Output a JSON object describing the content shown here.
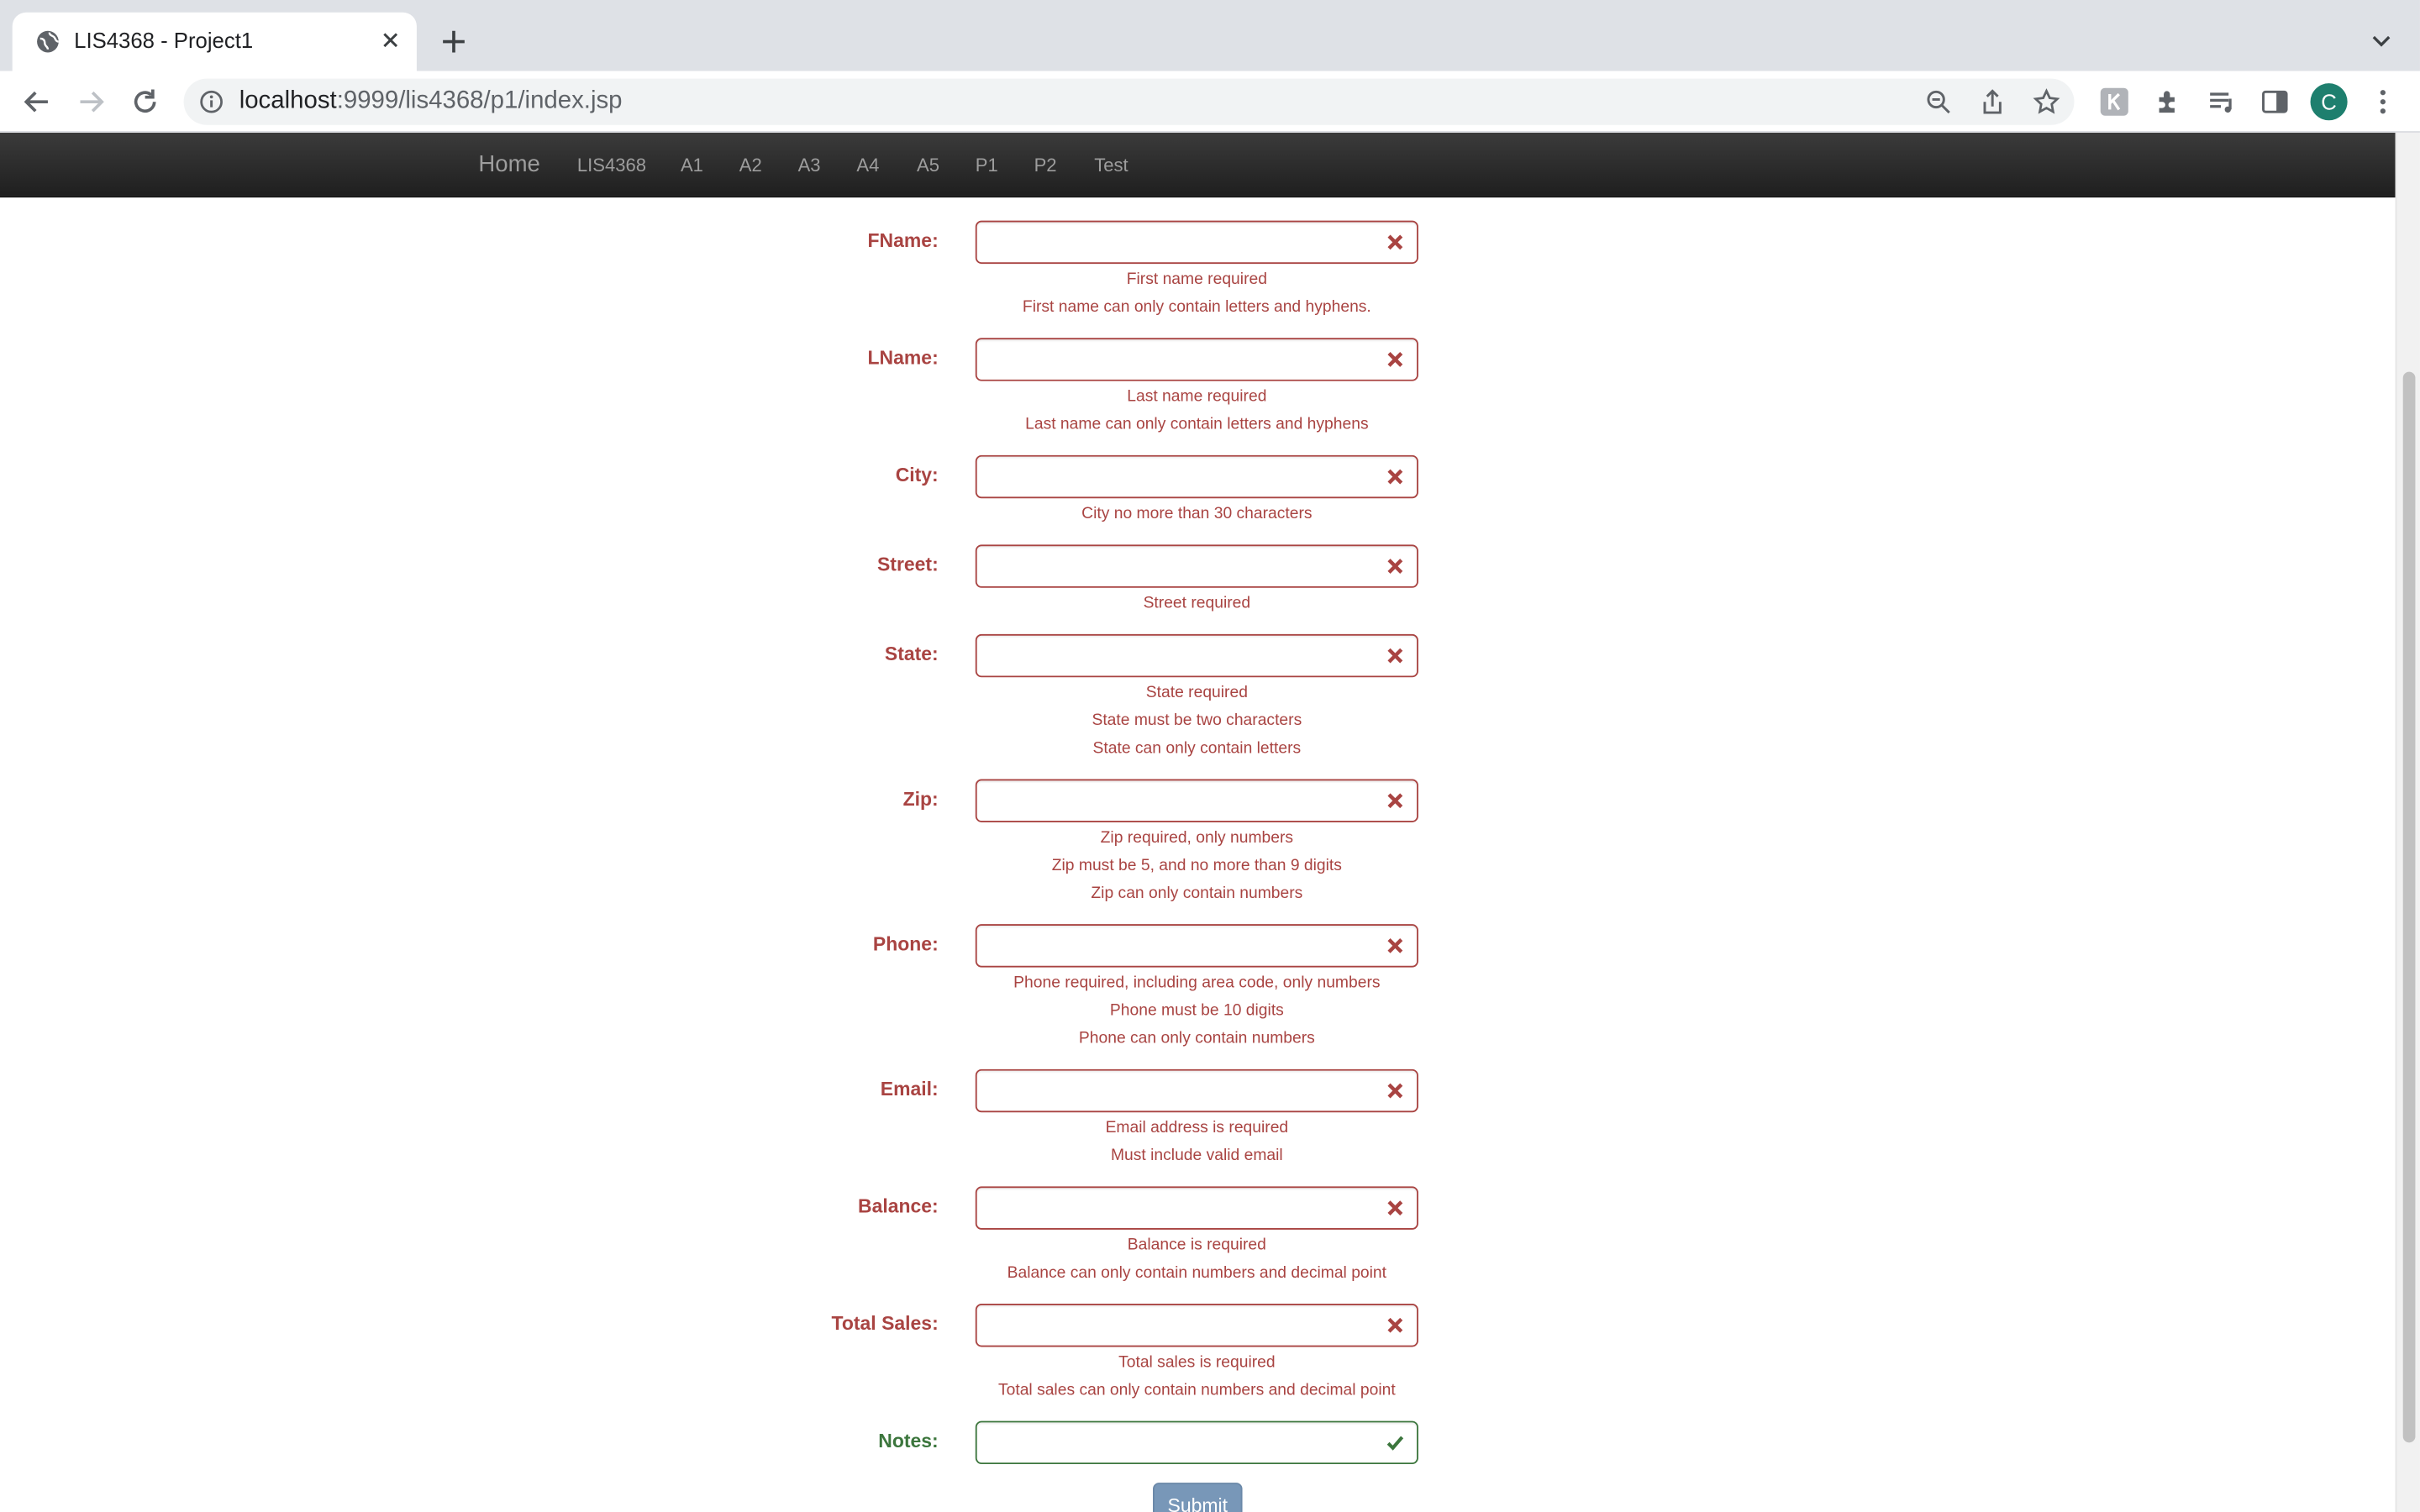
{
  "browser": {
    "tab_title": "LIS4368 - Project1",
    "url_host": "localhost",
    "url_rest": ":9999/lis4368/p1/index.jsp",
    "profile_initial": "C"
  },
  "nav": {
    "brand": "Home",
    "links": [
      "LIS4368",
      "A1",
      "A2",
      "A3",
      "A4",
      "A5",
      "P1",
      "P2",
      "Test"
    ]
  },
  "form": {
    "fields": [
      {
        "label": "FName:",
        "messages": [
          "First name required",
          "First name can only contain letters and hyphens."
        ]
      },
      {
        "label": "LName:",
        "messages": [
          "Last name required",
          "Last name can only contain letters and hyphens"
        ]
      },
      {
        "label": "City:",
        "messages": [
          "City no more than 30 characters"
        ]
      },
      {
        "label": "Street:",
        "messages": [
          "Street required"
        ]
      },
      {
        "label": "State:",
        "messages": [
          "State required",
          "State must be two characters",
          "State can only contain letters"
        ]
      },
      {
        "label": "Zip:",
        "messages": [
          "Zip required, only numbers",
          "Zip must be 5, and no more than 9 digits",
          "Zip can only contain numbers"
        ]
      },
      {
        "label": "Phone:",
        "messages": [
          "Phone required, including area code, only numbers",
          "Phone must be 10 digits",
          "Phone can only contain numbers"
        ]
      },
      {
        "label": "Email:",
        "messages": [
          "Email address is required",
          "Must include valid email"
        ]
      },
      {
        "label": "Balance:",
        "messages": [
          "Balance is required",
          "Balance can only contain numbers and decimal point"
        ]
      },
      {
        "label": "Total Sales:",
        "messages": [
          "Total sales is required",
          "Total sales can only contain numbers and decimal point"
        ]
      },
      {
        "label": "Notes:",
        "messages": []
      }
    ],
    "submit_label": "Submit"
  },
  "colors": {
    "error": "#a94442",
    "success": "#3c763d",
    "navbar": "#222222",
    "submit": "#7897b8"
  }
}
